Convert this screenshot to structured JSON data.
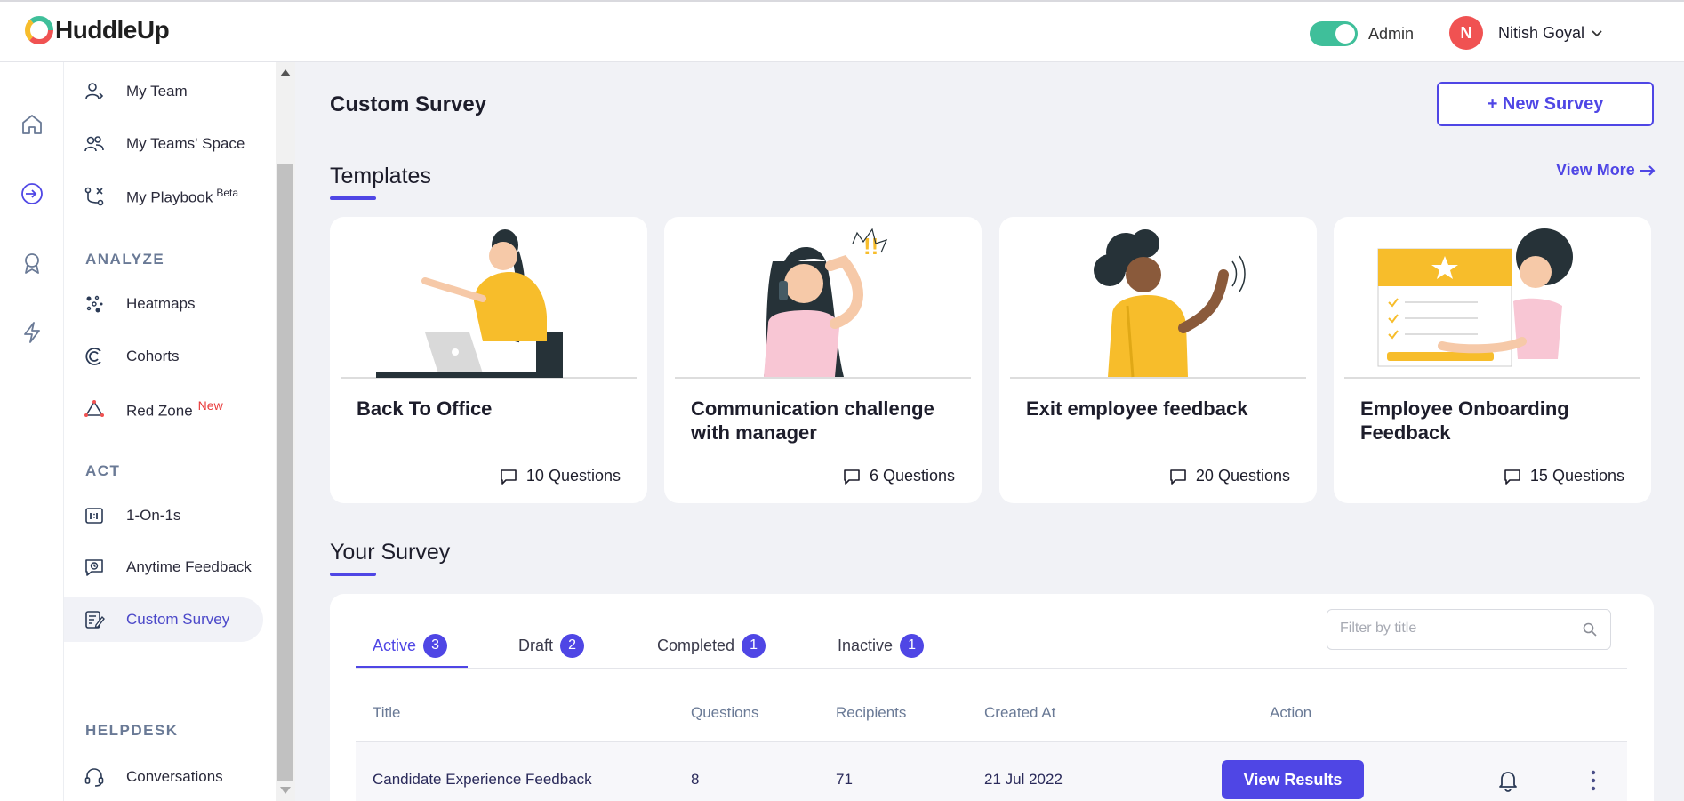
{
  "header": {
    "logo_text": "HuddleUp",
    "admin_label": "Admin",
    "admin_toggle_on": true,
    "avatar_initial": "N",
    "user_name": "Nitish Goyal"
  },
  "rail": {
    "icons": [
      "home-icon",
      "sign-in-icon",
      "award-icon",
      "lightning-icon"
    ]
  },
  "sidebar": {
    "items_top": [
      {
        "label": "My Team",
        "icon": "team-user-icon"
      },
      {
        "label": "My Teams' Space",
        "icon": "team-space-icon"
      },
      {
        "label": "My Playbook",
        "icon": "playbook-icon",
        "sup": "Beta"
      }
    ],
    "analyze_title": "ANALYZE",
    "analyze_items": [
      {
        "label": "Heatmaps",
        "icon": "heatmap-icon"
      },
      {
        "label": "Cohorts",
        "icon": "cohort-icon"
      },
      {
        "label": "Red Zone",
        "icon": "red-zone-icon",
        "sup": "New"
      }
    ],
    "act_title": "ACT",
    "act_items": [
      {
        "label": "1-On-1s",
        "icon": "one-on-one-icon"
      },
      {
        "label": "Anytime Feedback",
        "icon": "feedback-icon"
      },
      {
        "label": "Custom Survey",
        "icon": "survey-icon",
        "active": true
      }
    ],
    "helpdesk_title": "HELPDESK",
    "helpdesk_items": [
      {
        "label": "Conversations",
        "icon": "headset-icon"
      }
    ]
  },
  "main": {
    "page_title": "Custom Survey",
    "new_survey_label": "+ New Survey",
    "templates_heading": "Templates",
    "view_more_label": "View More",
    "templates": [
      {
        "title": "Back To Office",
        "questions": "10 Questions"
      },
      {
        "title": "Communication challenge with manager",
        "questions": "6 Questions"
      },
      {
        "title": "Exit employee feedback",
        "questions": "20 Questions"
      },
      {
        "title": "Employee Onboarding Feedback",
        "questions": "15 Questions"
      }
    ],
    "your_survey_heading": "Your Survey",
    "tabs": [
      {
        "label": "Active",
        "count": "3"
      },
      {
        "label": "Draft",
        "count": "2"
      },
      {
        "label": "Completed",
        "count": "1"
      },
      {
        "label": "Inactive",
        "count": "1"
      }
    ],
    "active_tab": "Active",
    "filter_placeholder": "Filter by title",
    "columns": [
      "Title",
      "Questions",
      "Recipients",
      "Created At",
      "Action"
    ],
    "rows": [
      {
        "title": "Candidate Experience Feedback",
        "questions": "8",
        "recipients": "71",
        "created_at": "21 Jul 2022",
        "action_label": "View Results"
      }
    ]
  },
  "colors": {
    "accent": "#4f46e5",
    "toggle_on": "#3fbf9a",
    "avatar_bg": "#f05252",
    "illustration_yellow": "#f7bd2b",
    "illustration_pink": "#f8c6d4"
  }
}
